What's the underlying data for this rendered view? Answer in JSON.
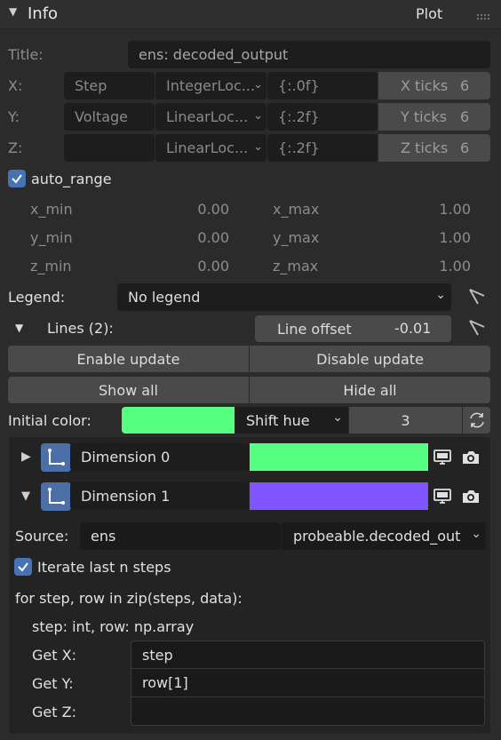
{
  "panel": {
    "title": "Info",
    "right_label": "Plot"
  },
  "form": {
    "title_label": "Title:",
    "title_value": "ens: decoded_output",
    "x": {
      "label": "X:",
      "name": "Step",
      "locator": "IntegerLoc...",
      "format": "{:.0f}",
      "ticks_label": "X ticks",
      "ticks": "6"
    },
    "y": {
      "label": "Y:",
      "name": "Voltage",
      "locator": "LinearLoc...",
      "format": "{:.2f}",
      "ticks_label": "Y ticks",
      "ticks": "6"
    },
    "z": {
      "label": "Z:",
      "name": "",
      "locator": "LinearLoc...",
      "format": "{:.2f}",
      "ticks_label": "Z ticks",
      "ticks": "6"
    },
    "auto_range_label": "auto_range",
    "ranges": {
      "x_min_label": "x_min",
      "x_min": "0.00",
      "x_max_label": "x_max",
      "x_max": "1.00",
      "y_min_label": "y_min",
      "y_min": "0.00",
      "y_max_label": "y_max",
      "y_max": "1.00",
      "z_min_label": "z_min",
      "z_min": "0.00",
      "z_max_label": "z_max",
      "z_max": "1.00"
    },
    "legend_label": "Legend:",
    "legend_value": "No legend",
    "lines_label": "Lines (2):",
    "line_offset_label": "Line offset",
    "line_offset_value": "-0.01",
    "enable_update": "Enable update",
    "disable_update": "Disable update",
    "show_all": "Show all",
    "hide_all": "Hide all",
    "initial_color_label": "Initial color:",
    "initial_color": "#55ff7f",
    "hue_mode": "Shift hue",
    "hue_count": "3"
  },
  "dimensions": [
    {
      "name": "Dimension 0",
      "color": "#55ff7f",
      "expanded": false
    },
    {
      "name": "Dimension 1",
      "color": "#7f55ff",
      "expanded": true
    }
  ],
  "detail": {
    "source_label": "Source:",
    "source_value": "ens",
    "probe_value": "probeable.decoded_out",
    "iterate_label": "Iterate last n steps",
    "code_line1": "for step, row in zip(steps, data):",
    "code_line2": "step: int, row: np.array",
    "get_x_label": "Get X:",
    "get_x_value": "step",
    "get_y_label": "Get Y:",
    "get_y_value": "row[1]",
    "get_z_label": "Get Z:",
    "get_z_value": ""
  }
}
